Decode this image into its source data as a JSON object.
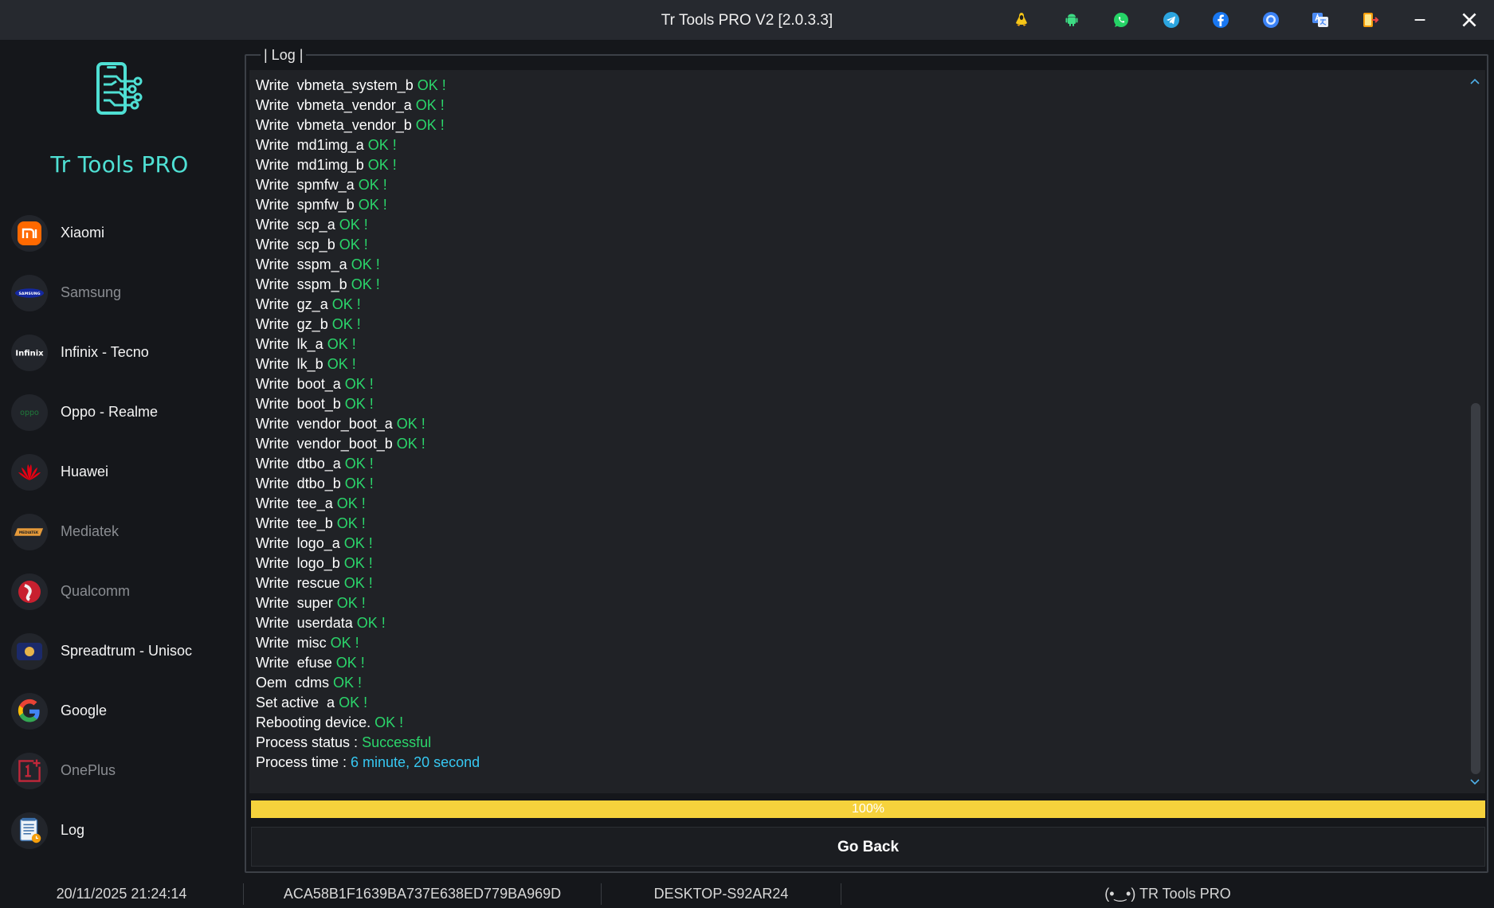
{
  "window": {
    "title": "Tr Tools PRO V2 [2.0.3.3]",
    "toolbar_icons": [
      {
        "icon": "linux-icon",
        "color": "#f5c518"
      },
      {
        "icon": "android-icon",
        "color": "#3ddc84"
      },
      {
        "icon": "whatsapp-icon",
        "color": "#25d366"
      },
      {
        "icon": "telegram-icon",
        "color": "#2ca5e0"
      },
      {
        "icon": "facebook-icon",
        "color": "#1877f2"
      },
      {
        "icon": "record-icon",
        "color": "#3b82f6"
      },
      {
        "icon": "translate-icon",
        "color": "#4a8af4"
      },
      {
        "icon": "account-switch-icon",
        "color": "#f59e0b"
      }
    ]
  },
  "app": {
    "name": "Tr Tools PRO",
    "accent": "#4fe0d4"
  },
  "sidebar": {
    "items": [
      {
        "label": "Xiaomi",
        "icon": "xiaomi-icon",
        "dim": false
      },
      {
        "label": "Samsung",
        "icon": "samsung-icon",
        "dim": true
      },
      {
        "label": "Infinix - Tecno",
        "icon": "infinix-icon",
        "dim": false
      },
      {
        "label": "Oppo - Realme",
        "icon": "oppo-icon",
        "dim": false
      },
      {
        "label": "Huawei",
        "icon": "huawei-icon",
        "dim": false
      },
      {
        "label": "Mediatek",
        "icon": "mediatek-icon",
        "dim": true
      },
      {
        "label": "Qualcomm",
        "icon": "qualcomm-icon",
        "dim": true
      },
      {
        "label": "Spreadtrum - Unisoc",
        "icon": "unisoc-icon",
        "dim": false
      },
      {
        "label": "Google",
        "icon": "google-icon",
        "dim": false
      },
      {
        "label": "OnePlus",
        "icon": "oneplus-icon",
        "dim": true
      },
      {
        "label": "Log",
        "icon": "log-icon",
        "dim": false
      }
    ]
  },
  "log_panel": {
    "legend": "| Log |",
    "lines": [
      [
        {
          "t": "Write  vbmeta_system_b ",
          "s": "w"
        },
        {
          "t": "OK !",
          "s": "g"
        }
      ],
      [
        {
          "t": "Write  vbmeta_vendor_a ",
          "s": "w"
        },
        {
          "t": "OK !",
          "s": "g"
        }
      ],
      [
        {
          "t": "Write  vbmeta_vendor_b ",
          "s": "w"
        },
        {
          "t": "OK !",
          "s": "g"
        }
      ],
      [
        {
          "t": "Write  md1img_a ",
          "s": "w"
        },
        {
          "t": "OK !",
          "s": "g"
        }
      ],
      [
        {
          "t": "Write  md1img_b ",
          "s": "w"
        },
        {
          "t": "OK !",
          "s": "g"
        }
      ],
      [
        {
          "t": "Write  spmfw_a ",
          "s": "w"
        },
        {
          "t": "OK !",
          "s": "g"
        }
      ],
      [
        {
          "t": "Write  spmfw_b ",
          "s": "w"
        },
        {
          "t": "OK !",
          "s": "g"
        }
      ],
      [
        {
          "t": "Write  scp_a ",
          "s": "w"
        },
        {
          "t": "OK !",
          "s": "g"
        }
      ],
      [
        {
          "t": "Write  scp_b ",
          "s": "w"
        },
        {
          "t": "OK !",
          "s": "g"
        }
      ],
      [
        {
          "t": "Write  sspm_a ",
          "s": "w"
        },
        {
          "t": "OK !",
          "s": "g"
        }
      ],
      [
        {
          "t": "Write  sspm_b ",
          "s": "w"
        },
        {
          "t": "OK !",
          "s": "g"
        }
      ],
      [
        {
          "t": "Write  gz_a ",
          "s": "w"
        },
        {
          "t": "OK !",
          "s": "g"
        }
      ],
      [
        {
          "t": "Write  gz_b ",
          "s": "w"
        },
        {
          "t": "OK !",
          "s": "g"
        }
      ],
      [
        {
          "t": "Write  lk_a ",
          "s": "w"
        },
        {
          "t": "OK !",
          "s": "g"
        }
      ],
      [
        {
          "t": "Write  lk_b ",
          "s": "w"
        },
        {
          "t": "OK !",
          "s": "g"
        }
      ],
      [
        {
          "t": "Write  boot_a ",
          "s": "w"
        },
        {
          "t": "OK !",
          "s": "g"
        }
      ],
      [
        {
          "t": "Write  boot_b ",
          "s": "w"
        },
        {
          "t": "OK !",
          "s": "g"
        }
      ],
      [
        {
          "t": "Write  vendor_boot_a ",
          "s": "w"
        },
        {
          "t": "OK !",
          "s": "g"
        }
      ],
      [
        {
          "t": "Write  vendor_boot_b ",
          "s": "w"
        },
        {
          "t": "OK !",
          "s": "g"
        }
      ],
      [
        {
          "t": "Write  dtbo_a ",
          "s": "w"
        },
        {
          "t": "OK !",
          "s": "g"
        }
      ],
      [
        {
          "t": "Write  dtbo_b ",
          "s": "w"
        },
        {
          "t": "OK !",
          "s": "g"
        }
      ],
      [
        {
          "t": "Write  tee_a ",
          "s": "w"
        },
        {
          "t": "OK !",
          "s": "g"
        }
      ],
      [
        {
          "t": "Write  tee_b ",
          "s": "w"
        },
        {
          "t": "OK !",
          "s": "g"
        }
      ],
      [
        {
          "t": "Write  logo_a ",
          "s": "w"
        },
        {
          "t": "OK !",
          "s": "g"
        }
      ],
      [
        {
          "t": "Write  logo_b ",
          "s": "w"
        },
        {
          "t": "OK !",
          "s": "g"
        }
      ],
      [
        {
          "t": "Write  rescue ",
          "s": "w"
        },
        {
          "t": "OK !",
          "s": "g"
        }
      ],
      [
        {
          "t": "Write  super ",
          "s": "w"
        },
        {
          "t": "OK !",
          "s": "g"
        }
      ],
      [
        {
          "t": "Write  userdata ",
          "s": "w"
        },
        {
          "t": "OK !",
          "s": "g"
        }
      ],
      [
        {
          "t": "Write  misc ",
          "s": "w"
        },
        {
          "t": "OK !",
          "s": "g"
        }
      ],
      [
        {
          "t": "Write  efuse ",
          "s": "w"
        },
        {
          "t": "OK !",
          "s": "g"
        }
      ],
      [
        {
          "t": "Oem  cdms ",
          "s": "w"
        },
        {
          "t": "OK !",
          "s": "g"
        }
      ],
      [
        {
          "t": "Set active  a ",
          "s": "w"
        },
        {
          "t": "OK !",
          "s": "g"
        }
      ],
      [
        {
          "t": "Rebooting device. ",
          "s": "w"
        },
        {
          "t": "OK !",
          "s": "g"
        }
      ],
      [
        {
          "t": "Process status : ",
          "s": "w"
        },
        {
          "t": "Successful",
          "s": "g"
        }
      ],
      [
        {
          "t": "Process time : ",
          "s": "w"
        },
        {
          "t": "6 minute, 20 second",
          "s": "c"
        }
      ]
    ]
  },
  "progress": {
    "value": 100,
    "label": "100%",
    "color": "#f6d23c"
  },
  "actions": {
    "go_back": "Go Back"
  },
  "statusbar": {
    "datetime": "20/11/2025  21:24:14",
    "hwid": "ACA58B1F1639BA737E638ED779BA969D",
    "computer": "DESKTOP-S92AR24",
    "brand": "(•‿•) TR Tools PRO"
  }
}
